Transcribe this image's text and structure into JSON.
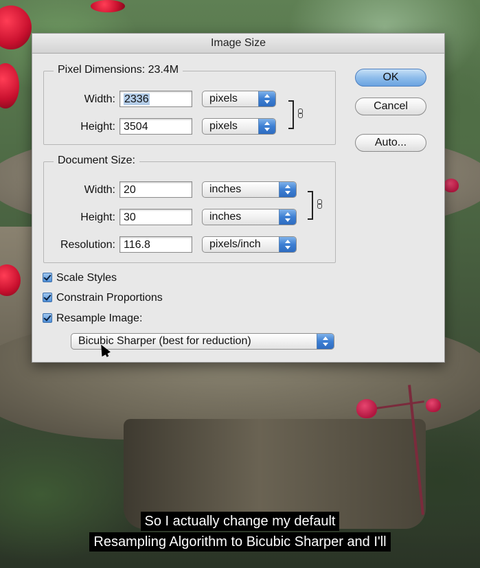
{
  "dialog": {
    "title": "Image Size",
    "pixel_dimensions": {
      "title": "Pixel Dimensions:  23.4M",
      "width_label": "Width:",
      "width_value": "2336",
      "width_unit": "pixels",
      "height_label": "Height:",
      "height_value": "3504",
      "height_unit": "pixels"
    },
    "document_size": {
      "title": "Document Size:",
      "width_label": "Width:",
      "width_value": "20",
      "width_unit": "inches",
      "height_label": "Height:",
      "height_value": "30",
      "height_unit": "inches",
      "resolution_label": "Resolution:",
      "resolution_value": "116.8",
      "resolution_unit": "pixels/inch"
    },
    "buttons": {
      "ok": "OK",
      "cancel": "Cancel",
      "auto": "Auto..."
    },
    "checkboxes": {
      "scale_styles": "Scale Styles",
      "constrain_proportions": "Constrain Proportions",
      "resample_image": "Resample Image:"
    },
    "resample_method": "Bicubic Sharper (best for reduction)"
  },
  "caption": {
    "line1": "So I actually change my default",
    "line2": "Resampling Algorithm to Bicubic Sharper and I'll"
  },
  "colors": {
    "dialog_bg": "#e8e8e8",
    "accent_blue": "#3d7fd3",
    "caption_bg": "#000000",
    "caption_text": "#ffffff"
  }
}
